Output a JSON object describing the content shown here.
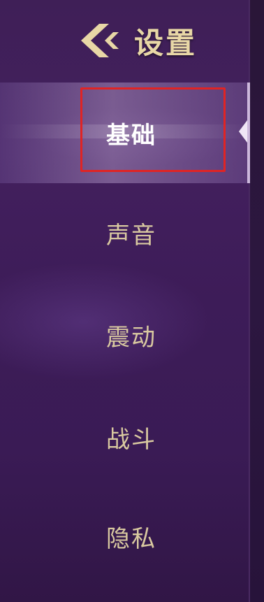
{
  "header": {
    "title": "设置",
    "back_icon": "back-chevron-icon"
  },
  "menu": {
    "items": [
      {
        "label": "基础",
        "active": true
      },
      {
        "label": "声音",
        "active": false
      },
      {
        "label": "震动",
        "active": false
      },
      {
        "label": "战斗",
        "active": false
      },
      {
        "label": "隐私",
        "active": false
      }
    ]
  },
  "colors": {
    "background": "#3f1f57",
    "title": "#e8d7a6",
    "label": "#d9c9a0",
    "active_label": "#ffffff",
    "highlight_border": "#e02424"
  }
}
